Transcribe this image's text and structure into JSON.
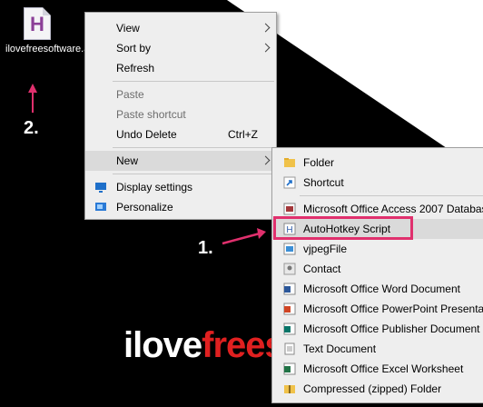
{
  "desktop": {
    "icon_letter": "H",
    "icon_label": "ilovefreesoftware.ahk",
    "brand_part1": "ilove",
    "brand_part2": "frees"
  },
  "callouts": {
    "one": "1.",
    "two": "2."
  },
  "context_menu": {
    "items": [
      {
        "label": "View"
      },
      {
        "label": "Sort by"
      },
      {
        "label": "Refresh"
      },
      {
        "label": "Paste"
      },
      {
        "label": "Paste shortcut"
      },
      {
        "label": "Undo Delete",
        "shortcut": "Ctrl+Z"
      },
      {
        "label": "New"
      },
      {
        "label": "Display settings"
      },
      {
        "label": "Personalize"
      }
    ]
  },
  "new_submenu": {
    "items": [
      {
        "label": "Folder",
        "icon": "folder-icon"
      },
      {
        "label": "Shortcut",
        "icon": "shortcut-icon"
      },
      {
        "label": "Microsoft Office Access 2007 Databas",
        "icon": "access-icon"
      },
      {
        "label": "AutoHotkey Script",
        "icon": "autohotkey-icon"
      },
      {
        "label": "vjpegFile",
        "icon": "image-file-icon"
      },
      {
        "label": "Contact",
        "icon": "contact-icon"
      },
      {
        "label": "Microsoft Office Word Document",
        "icon": "word-icon"
      },
      {
        "label": "Microsoft Office PowerPoint Presenta",
        "icon": "powerpoint-icon"
      },
      {
        "label": "Microsoft Office Publisher Document",
        "icon": "publisher-icon"
      },
      {
        "label": "Text Document",
        "icon": "text-document-icon"
      },
      {
        "label": "Microsoft Office Excel Worksheet",
        "icon": "excel-icon"
      },
      {
        "label": "Compressed (zipped) Folder",
        "icon": "zip-folder-icon"
      }
    ]
  },
  "colors": {
    "menu_bg": "#eeeeee",
    "hover_bg": "#dadada",
    "annotation": "#e0306d",
    "brand_red": "#e02020"
  }
}
